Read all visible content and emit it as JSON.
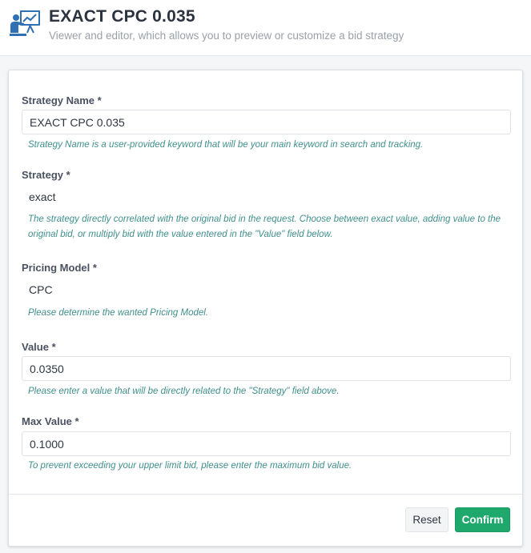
{
  "header": {
    "title": "EXACT CPC 0.035",
    "subtitle": "Viewer and editor, which allows you to preview or customize a bid strategy",
    "icon": "presenter-board-icon",
    "accent_color": "#2f6fb3"
  },
  "form": {
    "strategy_name": {
      "label": "Strategy Name *",
      "value": "EXACT CPC 0.035",
      "help": "Strategy Name is a user-provided keyword that will be your main keyword in search and tracking."
    },
    "strategy": {
      "label": "Strategy *",
      "value": "exact",
      "help": "The strategy directly correlated with the original bid in the request. Choose between exact value, adding value to the original bid, or multiply bid with the value entered in the \"Value\" field below."
    },
    "pricing_model": {
      "label": "Pricing Model *",
      "value": "CPC",
      "help": "Please determine the wanted Pricing Model."
    },
    "value": {
      "label": "Value *",
      "value": "0.0350",
      "help": "Please enter a value that will be directly related to the \"Strategy\" field above."
    },
    "max_value": {
      "label": "Max Value *",
      "value": "0.1000",
      "help": "To prevent exceeding your upper limit bid, please enter the maximum bid value."
    }
  },
  "actions": {
    "reset_label": "Reset",
    "confirm_label": "Confirm",
    "confirm_color": "#1fa86b"
  }
}
